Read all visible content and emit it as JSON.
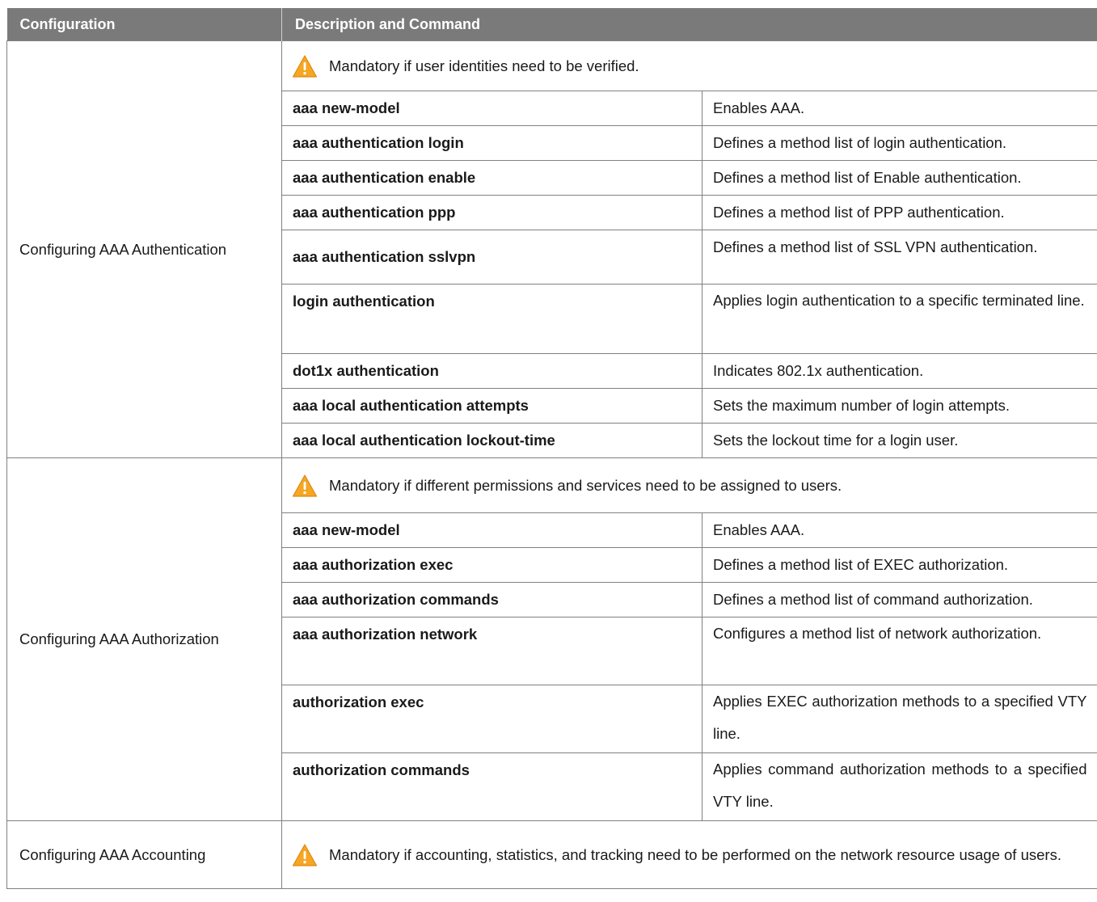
{
  "table": {
    "headers": [
      "Configuration",
      "Description and Command"
    ],
    "sections": [
      {
        "configuration": "Configuring AAA Authentication",
        "note": "Mandatory if user identities need to be verified.",
        "rows": [
          {
            "command": "aaa new-model",
            "description": "Enables AAA."
          },
          {
            "command": "aaa authentication login",
            "description": "Defines a method list of login authentication."
          },
          {
            "command": "aaa authentication enable",
            "description": "Defines a method list of Enable authentication."
          },
          {
            "command": "aaa authentication ppp",
            "description": "Defines a method list of PPP authentication."
          },
          {
            "command": "aaa authentication sslvpn",
            "description": "Defines a method list of SSL VPN authentication."
          },
          {
            "command": "login authentication",
            "description": "Applies login authentication to a specific terminated line."
          },
          {
            "command": "dot1x authentication",
            "description": "Indicates 802.1x authentication."
          },
          {
            "command": "aaa local authentication attempts",
            "description": "Sets the maximum number of login attempts."
          },
          {
            "command": "aaa local authentication lockout-time",
            "description": "Sets the lockout time for a login user."
          }
        ]
      },
      {
        "configuration": "Configuring AAA Authorization",
        "note": "Mandatory if different permissions and services need to be assigned to users.",
        "rows": [
          {
            "command": "aaa new-model",
            "description": "Enables AAA."
          },
          {
            "command": "aaa authorization exec",
            "description": "Defines a method list of EXEC authorization."
          },
          {
            "command": "aaa authorization commands",
            "description": "Defines a method list of command authorization."
          },
          {
            "command": "aaa authorization network",
            "description": "Configures a method list of network authorization."
          },
          {
            "command": "authorization exec",
            "description": "Applies EXEC authorization methods to a specified VTY line."
          },
          {
            "command": "authorization commands",
            "description": "Applies command authorization methods to a specified VTY line."
          }
        ]
      },
      {
        "configuration": "Configuring AAA Accounting",
        "note": "Mandatory if accounting, statistics, and tracking need to be performed on the network resource usage of users."
      }
    ]
  },
  "icons": {
    "warning": "warning-icon"
  },
  "colors": {
    "header_bg": "#7a7a7a",
    "warning_fill": "#f5a623",
    "border": "#808080"
  }
}
